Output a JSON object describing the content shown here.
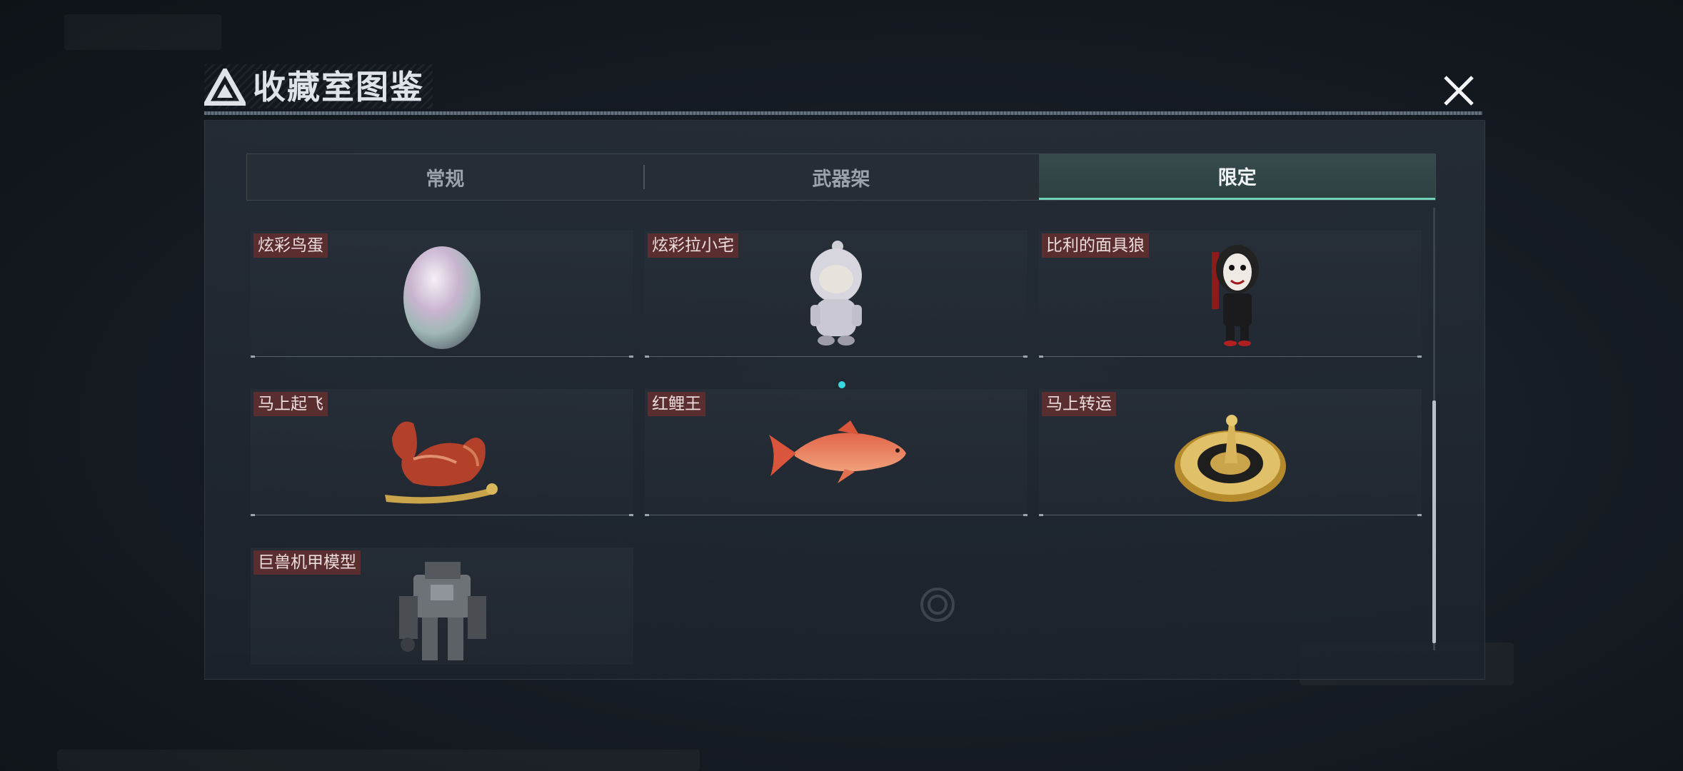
{
  "header": {
    "title": "收藏室图鉴"
  },
  "tabs": [
    {
      "label": "常规",
      "active": false
    },
    {
      "label": "武器架",
      "active": false
    },
    {
      "label": "限定",
      "active": true
    }
  ],
  "items": [
    {
      "label": "炫彩鸟蛋",
      "icon": "egg-icon"
    },
    {
      "label": "炫彩拉小宅",
      "icon": "figurine-icon"
    },
    {
      "label": "比利的面具狼",
      "icon": "puppet-figure-icon"
    },
    {
      "label": "马上起飞",
      "icon": "horse-statue-icon"
    },
    {
      "label": "红鲤王",
      "icon": "carp-icon"
    },
    {
      "label": "马上转运",
      "icon": "golden-wheel-icon"
    },
    {
      "label": "巨兽机甲模型",
      "icon": "mech-model-icon"
    }
  ],
  "colors": {
    "accent": "#6fd0b3",
    "label_bg": "#5a2e2f",
    "indicator_dot": "#37d8e0"
  }
}
